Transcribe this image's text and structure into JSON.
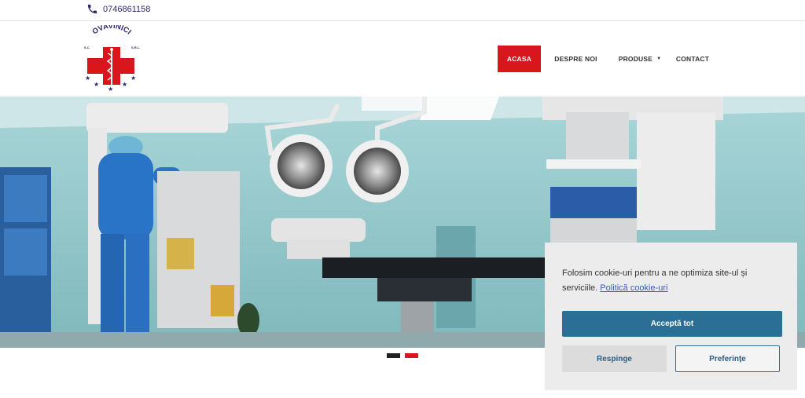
{
  "topbar": {
    "phone": "0746861158",
    "phone_icon": "phone-icon"
  },
  "logo": {
    "top_text": "OVAVINICI",
    "prefix": "S.C.",
    "suffix": "S.R.L."
  },
  "nav": {
    "items": [
      {
        "label": "ACASA",
        "active": true
      },
      {
        "label": "DESPRE NOI",
        "active": false
      },
      {
        "label": "PRODUSE",
        "active": false,
        "has_dropdown": true
      },
      {
        "label": "CONTACT",
        "active": false
      }
    ],
    "active_color": "#d9161c"
  },
  "hero": {
    "image_subject": "operating-room-photo"
  },
  "carousel": {
    "slides": 2,
    "active_index": 1,
    "colors": {
      "inactive": "#222222",
      "active": "#d9161c"
    }
  },
  "cookie": {
    "text": "Folosim cookie-uri pentru a ne optimiza site-ul și serviciile.",
    "link": "Politică cookie-uri",
    "accept": "Acceptă tot",
    "reject": "Respinge",
    "preferences": "Preferințe",
    "accent_color": "#2b6e96"
  }
}
